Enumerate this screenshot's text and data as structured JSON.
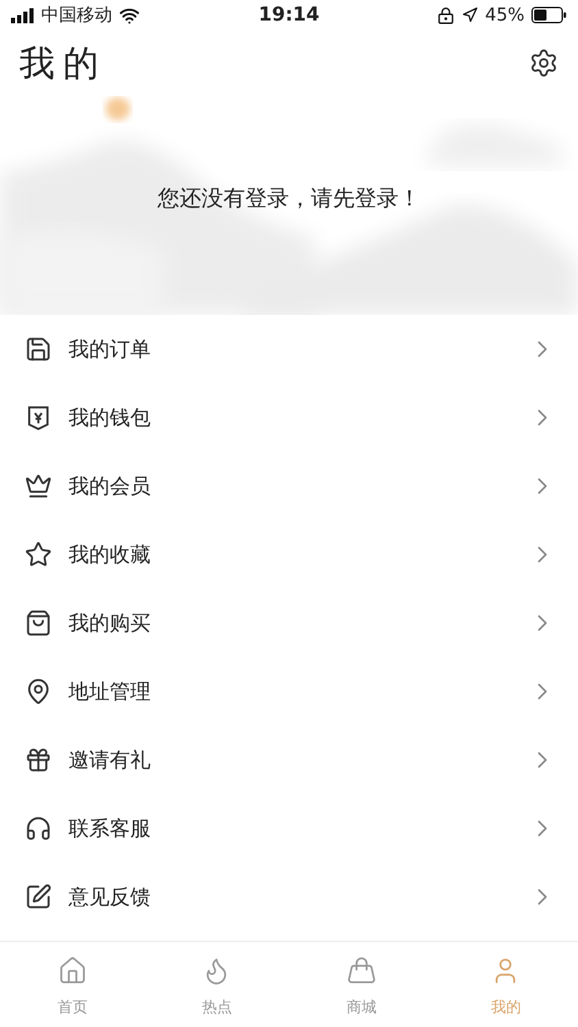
{
  "status_bar": {
    "carrier": "中国移动",
    "time": "19:14",
    "battery": "45%"
  },
  "header": {
    "title": "我的"
  },
  "hero": {
    "message": "您还没有登录，请先登录！"
  },
  "menu": [
    {
      "kind": "order",
      "label": "我的订单"
    },
    {
      "kind": "wallet",
      "label": "我的钱包"
    },
    {
      "kind": "member",
      "label": "我的会员"
    },
    {
      "kind": "favorite",
      "label": "我的收藏"
    },
    {
      "kind": "purchase",
      "label": "我的购买"
    },
    {
      "kind": "address",
      "label": "地址管理"
    },
    {
      "kind": "invite",
      "label": "邀请有礼"
    },
    {
      "kind": "service",
      "label": "联系客服"
    },
    {
      "kind": "feedback",
      "label": "意见反馈"
    }
  ],
  "tab_bar": [
    {
      "kind": "home",
      "label": "首页",
      "selected": false
    },
    {
      "kind": "hot",
      "label": "热点",
      "selected": false
    },
    {
      "kind": "mall",
      "label": "商城",
      "selected": false
    },
    {
      "kind": "me",
      "label": "我的",
      "selected": true
    }
  ]
}
